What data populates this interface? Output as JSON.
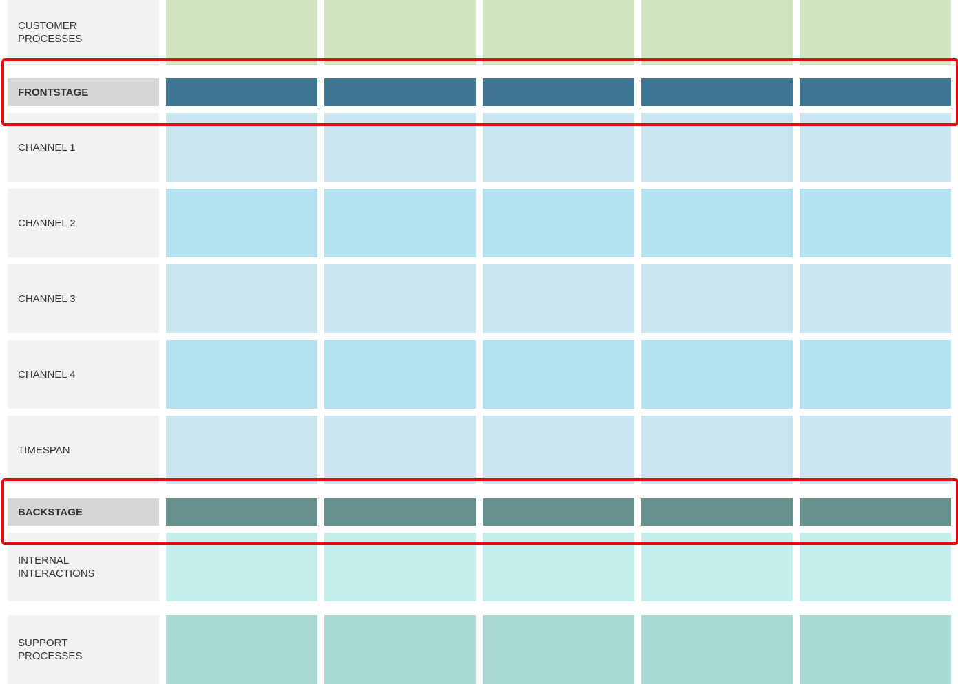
{
  "rows": [
    {
      "label": "CUSTOMER\nPROCESSES",
      "color": "#d1e5c0",
      "header": false
    },
    {
      "label": "FRONTSTAGE",
      "color": "#3e7691",
      "header": true
    },
    {
      "label": "CHANNEL 1",
      "color": "#c9e6f0",
      "header": false
    },
    {
      "label": "CHANNEL 2",
      "color": "#b3e1f0",
      "header": false
    },
    {
      "label": "CHANNEL 3",
      "color": "#c9e6f0",
      "header": false
    },
    {
      "label": "CHANNEL 4",
      "color": "#b3e1f0",
      "header": false
    },
    {
      "label": "TIMESPAN",
      "color": "#c9e6f0",
      "header": false
    },
    {
      "label": "BACKSTAGE",
      "color": "#65928f",
      "header": true
    },
    {
      "label": "INTERNAL\nINTERACTIONS",
      "color": "#c2efeb",
      "header": false
    },
    {
      "label": "SUPPORT\nPROCESSES",
      "color": "#aad8d5",
      "header": false
    }
  ],
  "highlight_color": "#e30b0b"
}
